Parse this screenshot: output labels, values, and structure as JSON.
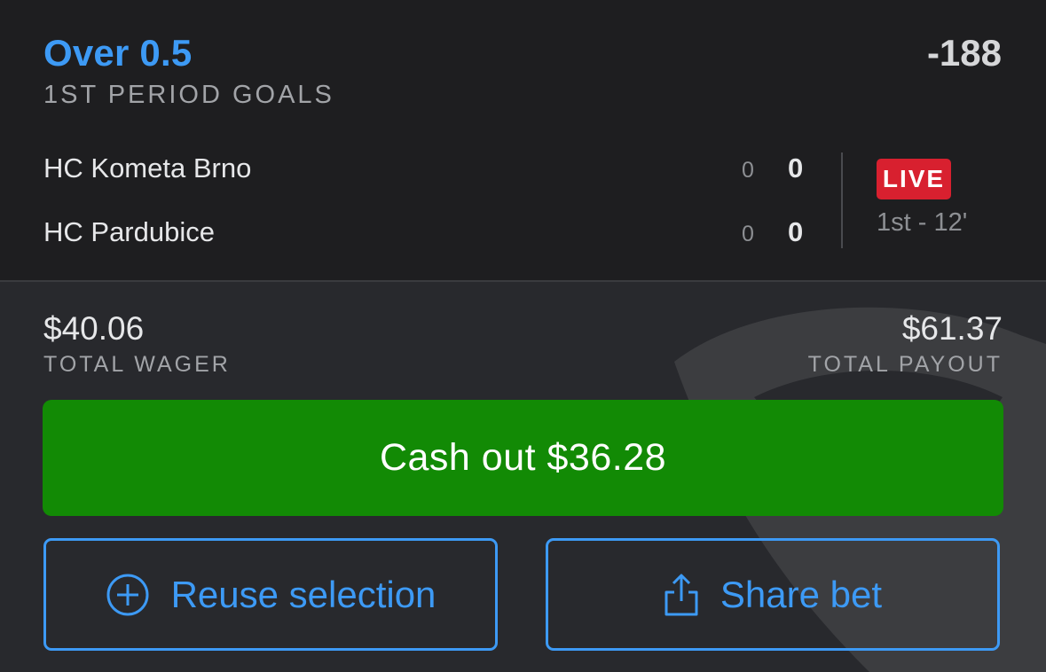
{
  "selection": {
    "title": "Over 0.5",
    "market": "1ST PERIOD GOALS",
    "odds": "-188"
  },
  "game": {
    "teams": [
      {
        "name": "HC Kometa Brno",
        "period_score": "0",
        "total_score": "0"
      },
      {
        "name": "HC Pardubice",
        "period_score": "0",
        "total_score": "0"
      }
    ],
    "status_badge": "LIVE",
    "clock": "1st - 12'"
  },
  "wager": {
    "total_wager": "$40.06",
    "total_wager_label": "TOTAL WAGER",
    "total_payout": "$61.37",
    "total_payout_label": "TOTAL PAYOUT"
  },
  "actions": {
    "cashout_label": "Cash out $36.28",
    "reuse_label": "Reuse selection",
    "reuse_icon": "plus-circle-icon",
    "share_label": "Share bet",
    "share_icon": "share-icon"
  },
  "colors": {
    "accent_blue": "#3d9af5",
    "cashout_green": "#128a05",
    "live_red": "#d8202f"
  }
}
